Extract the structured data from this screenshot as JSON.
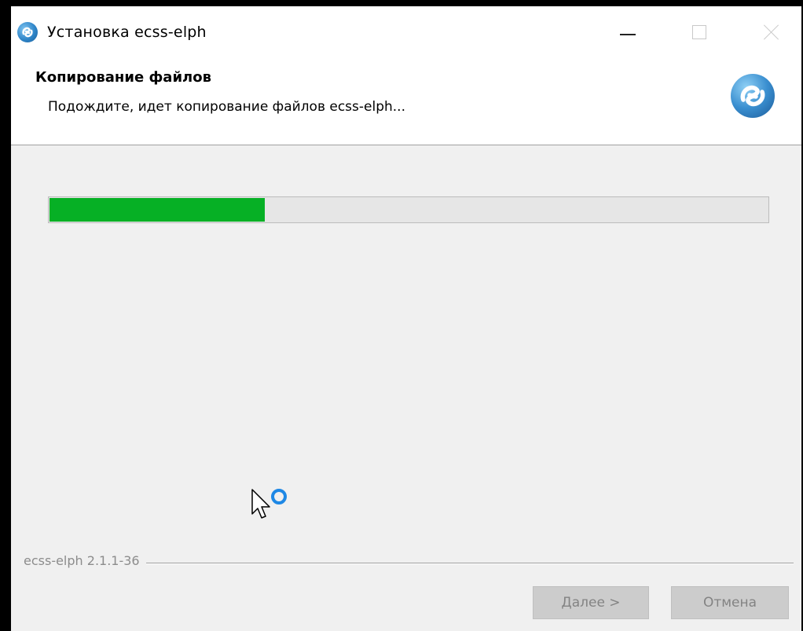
{
  "window": {
    "title": "Установка ecss-elph",
    "app_icon": "ecss-logo-icon",
    "controls": [
      "minimize-icon",
      "maximize-icon",
      "close-icon"
    ]
  },
  "header": {
    "title": "Копирование файлов",
    "subtitle": "Подождите, идет копирование файлов ecss-elph..."
  },
  "progress": {
    "value": 0.3,
    "color": "#06b025"
  },
  "footer": {
    "version": "ecss-elph 2.1.1-36",
    "next_label": "Далее >",
    "cancel_label": "Отмена"
  },
  "cursor": {
    "icon": "busy-arrow-cursor-icon"
  }
}
